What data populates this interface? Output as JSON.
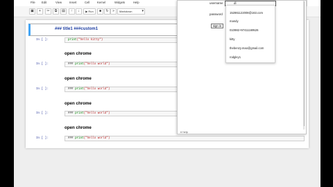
{
  "menubar": {
    "items": [
      "File",
      "Edit",
      "View",
      "Insert",
      "Cell",
      "Kernel",
      "Widgets",
      "Help"
    ]
  },
  "toolbar": {
    "run_label": "▶ Run",
    "cell_type": "Markdown",
    "buttons": [
      "save-icon",
      "plus-icon",
      "cut-icon",
      "copy-icon",
      "paste-icon",
      "arrow-up-icon",
      "arrow-down-icon",
      "stop-icon",
      "restart-icon",
      "fast-forward-icon"
    ]
  },
  "cells": {
    "md_title": "### title1 ###custom1",
    "c1_prompt": "In [ ]:",
    "c1_code": {
      "fn": "print",
      "arg": "(\"hello kitty\")"
    },
    "h1": "open chrome",
    "c2_prompt": "In [ ]:",
    "c2_code": {
      "pre": "### ",
      "fn": "print",
      "arg": "(\"hello world\")"
    },
    "h2": "open chrome",
    "c3_prompt": "In [ ]:",
    "c3_code": {
      "pre": "### ",
      "fn": "print",
      "arg": "(\"hello world\")"
    },
    "h3": "open chrome",
    "c4_prompt": "In [ ]:",
    "c4_code": {
      "pre": "### ",
      "fn": "print",
      "arg": "(\"hello world\")"
    },
    "h4": "open chrome",
    "c5_prompt": "In [ ]:",
    "c5_code": {
      "pre": "### ",
      "fn": "print",
      "arg": "(\"hello world\")"
    }
  },
  "popup": {
    "username_label": "username",
    "username_value": "dl",
    "password_label": "password",
    "signin_label": "sign in",
    "footer": "# help"
  },
  "dropdown": {
    "items": [
      "152861122008@163.com",
      "mandy",
      "010982+97411169526",
      "kitty",
      "thebenzy.mao@gmail.com",
      "rodgley1"
    ]
  },
  "colors": {
    "accent": "#42a5f5",
    "prompt": "#303f9f",
    "keyword": "#008000",
    "string": "#ba2121"
  }
}
